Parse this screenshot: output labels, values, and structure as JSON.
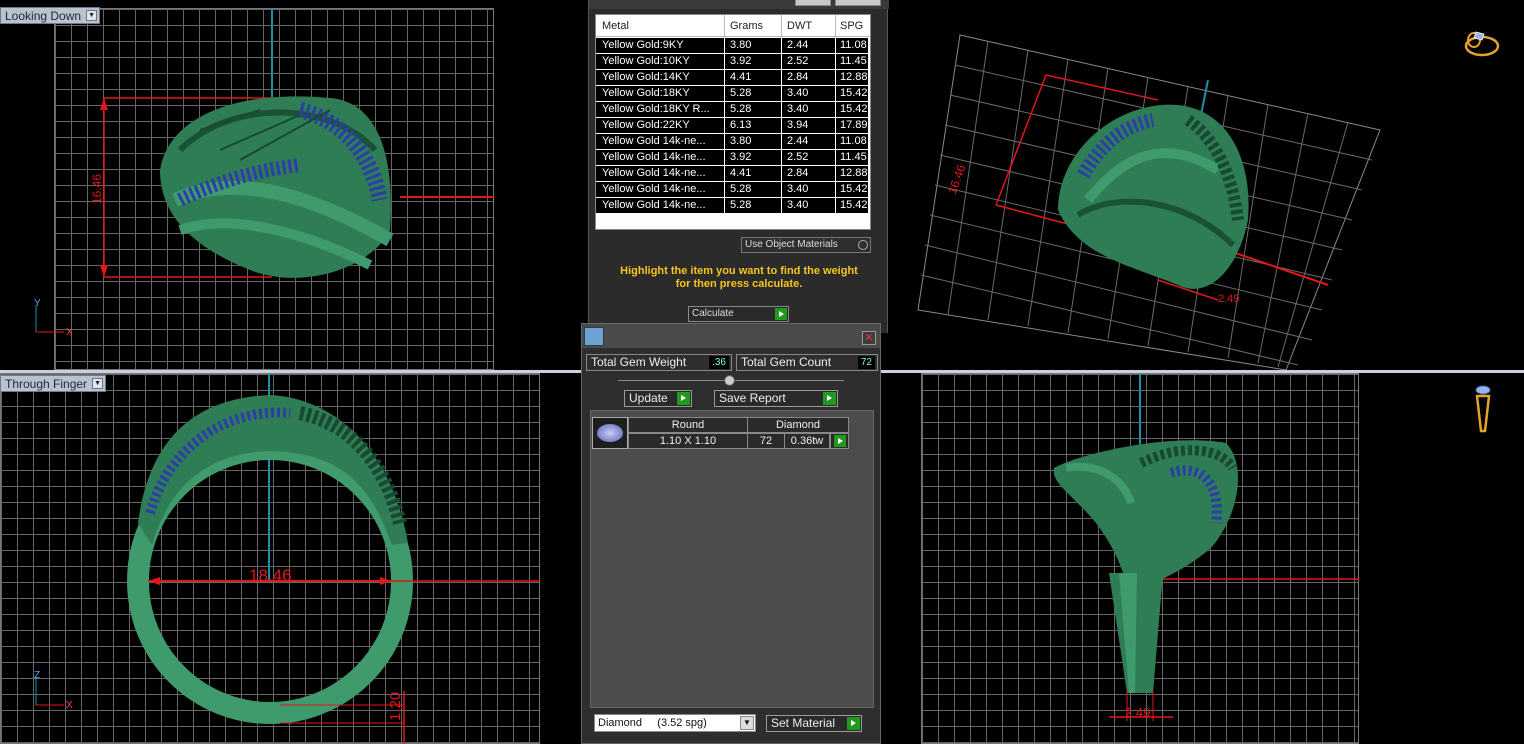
{
  "viewports": {
    "top_left": {
      "label": "Looking Down",
      "dimension": "16.46",
      "axis_v": "Y",
      "axis_h": "X"
    },
    "top_right": {
      "dimension_a": "16.46",
      "dimension_b": "2.49"
    },
    "bottom_left": {
      "label": "Through Finger",
      "dimension_a": "18.46",
      "dimension_b": "1.20",
      "axis_v": "Z",
      "axis_h": "X"
    },
    "bottom_right": {
      "dimension": "2.49"
    }
  },
  "weight_panel": {
    "columns": [
      "Metal",
      "Grams",
      "DWT",
      "SPG"
    ],
    "rows": [
      [
        "Yellow Gold:9KY",
        "3.80",
        "2.44",
        "11.08"
      ],
      [
        "Yellow Gold:10KY",
        "3.92",
        "2.52",
        "11.45"
      ],
      [
        "Yellow Gold:14KY",
        "4.41",
        "2.84",
        "12.88"
      ],
      [
        "Yellow Gold:18KY",
        "5.28",
        "3.40",
        "15.42"
      ],
      [
        "Yellow Gold:18KY R...",
        "5.28",
        "3.40",
        "15.42"
      ],
      [
        "Yellow Gold:22KY",
        "6.13",
        "3.94",
        "17.89"
      ],
      [
        "Yellow Gold 14k-ne...",
        "3.80",
        "2.44",
        "11.08"
      ],
      [
        "Yellow Gold 14k-ne...",
        "3.92",
        "2.52",
        "11.45"
      ],
      [
        "Yellow Gold 14k-ne...",
        "4.41",
        "2.84",
        "12.88"
      ],
      [
        "Yellow Gold 14k-ne...",
        "5.28",
        "3.40",
        "15.42"
      ],
      [
        "Yellow Gold 14k-ne...",
        "5.28",
        "3.40",
        "15.42"
      ]
    ],
    "use_object_materials": "Use Object Materials",
    "hint_line1": "Highlight the item you want to find the weight",
    "hint_line2": "for then press calculate.",
    "calculate_label": "Calculate"
  },
  "gem_panel": {
    "total_weight_label": "Total Gem Weight",
    "total_weight_value": ".36",
    "total_count_label": "Total Gem Count",
    "total_count_value": "72",
    "update_label": "Update",
    "save_report_label": "Save Report",
    "gem_headers": [
      "Round",
      "Diamond"
    ],
    "gem_row": {
      "size": "1.10 X 1.10",
      "count": "72",
      "weight": "0.36tw"
    },
    "material_select": "Diamond     (3.52 spg)",
    "set_material_label": "Set Material"
  },
  "colors": {
    "ring_green": "#2e7d55",
    "gem_blue": "#2b3fa6",
    "dimension_red": "#e01818",
    "axis_cyan": "#1f8ea8",
    "hint_yellow": "#f7c51e"
  }
}
